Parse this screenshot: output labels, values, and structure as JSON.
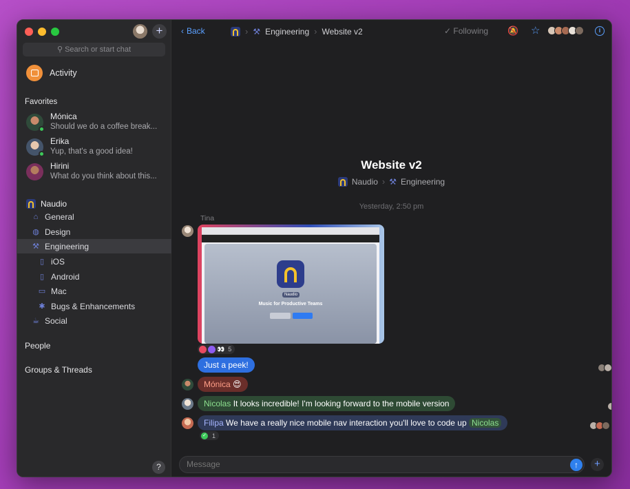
{
  "sidebar": {
    "search_placeholder": "Search or start chat",
    "activity_label": "Activity",
    "favorites_title": "Favorites",
    "favorites": [
      {
        "name": "Mónica",
        "message": "Should we do a coffee break..."
      },
      {
        "name": "Erika",
        "message": "Yup, that's a good idea!"
      },
      {
        "name": "Hirini",
        "message": "What do you think about this..."
      }
    ],
    "workspace_name": "Naudio",
    "channels": [
      {
        "label": "General"
      },
      {
        "label": "Design"
      },
      {
        "label": "Engineering"
      },
      {
        "label": "iOS"
      },
      {
        "label": "Android"
      },
      {
        "label": "Mac"
      },
      {
        "label": "Bugs & Enhancements"
      },
      {
        "label": "Social"
      }
    ],
    "people_title": "People",
    "groups_title": "Groups & Threads",
    "help_label": "?"
  },
  "header": {
    "back_label": "Back",
    "crumb_parent": "Engineering",
    "crumb_current": "Website v2",
    "following_label": "Following"
  },
  "channel": {
    "title": "Website v2",
    "workspace": "Naudio",
    "parent": "Engineering"
  },
  "timeline": {
    "day_label": "Yesterday, 2:50 pm",
    "sender_tina": "Tina",
    "screenshot": {
      "tag": "Naudio",
      "headline": "Music for Productive Teams"
    },
    "reaction_count": "5",
    "msg_peek": "Just a peek!",
    "msg_monica_name": "Mónica",
    "msg_monica_emoji": "😍",
    "msg_nicolas_name": "Nicolas",
    "msg_nicolas_text": "It looks incredible! I'm looking forward to the mobile version",
    "msg_filipa_name": "Filipa",
    "msg_filipa_text": "We have a really nice mobile nav interaction you'll love to code up",
    "msg_filipa_mention": "Nicolas",
    "check_count": "1"
  },
  "composer": {
    "placeholder": "Message"
  },
  "colors": {
    "accent": "#5ba0ff",
    "send": "#2f80ed",
    "online": "#3dc95a"
  }
}
